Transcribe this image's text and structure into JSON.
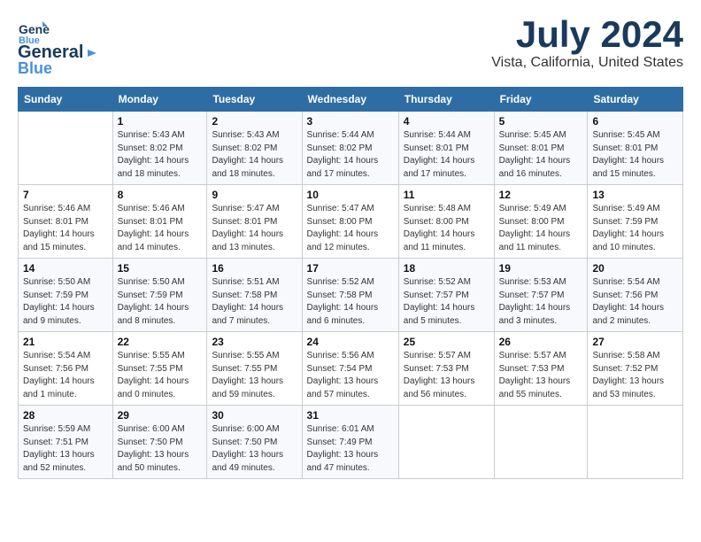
{
  "header": {
    "logo_general": "General",
    "logo_blue": "Blue",
    "month": "July 2024",
    "location": "Vista, California, United States"
  },
  "columns": [
    "Sunday",
    "Monday",
    "Tuesday",
    "Wednesday",
    "Thursday",
    "Friday",
    "Saturday"
  ],
  "weeks": [
    [
      {
        "num": "",
        "info": ""
      },
      {
        "num": "1",
        "info": "Sunrise: 5:43 AM\nSunset: 8:02 PM\nDaylight: 14 hours\nand 18 minutes."
      },
      {
        "num": "2",
        "info": "Sunrise: 5:43 AM\nSunset: 8:02 PM\nDaylight: 14 hours\nand 18 minutes."
      },
      {
        "num": "3",
        "info": "Sunrise: 5:44 AM\nSunset: 8:02 PM\nDaylight: 14 hours\nand 17 minutes."
      },
      {
        "num": "4",
        "info": "Sunrise: 5:44 AM\nSunset: 8:01 PM\nDaylight: 14 hours\nand 17 minutes."
      },
      {
        "num": "5",
        "info": "Sunrise: 5:45 AM\nSunset: 8:01 PM\nDaylight: 14 hours\nand 16 minutes."
      },
      {
        "num": "6",
        "info": "Sunrise: 5:45 AM\nSunset: 8:01 PM\nDaylight: 14 hours\nand 15 minutes."
      }
    ],
    [
      {
        "num": "7",
        "info": "Sunrise: 5:46 AM\nSunset: 8:01 PM\nDaylight: 14 hours\nand 15 minutes."
      },
      {
        "num": "8",
        "info": "Sunrise: 5:46 AM\nSunset: 8:01 PM\nDaylight: 14 hours\nand 14 minutes."
      },
      {
        "num": "9",
        "info": "Sunrise: 5:47 AM\nSunset: 8:01 PM\nDaylight: 14 hours\nand 13 minutes."
      },
      {
        "num": "10",
        "info": "Sunrise: 5:47 AM\nSunset: 8:00 PM\nDaylight: 14 hours\nand 12 minutes."
      },
      {
        "num": "11",
        "info": "Sunrise: 5:48 AM\nSunset: 8:00 PM\nDaylight: 14 hours\nand 11 minutes."
      },
      {
        "num": "12",
        "info": "Sunrise: 5:49 AM\nSunset: 8:00 PM\nDaylight: 14 hours\nand 11 minutes."
      },
      {
        "num": "13",
        "info": "Sunrise: 5:49 AM\nSunset: 7:59 PM\nDaylight: 14 hours\nand 10 minutes."
      }
    ],
    [
      {
        "num": "14",
        "info": "Sunrise: 5:50 AM\nSunset: 7:59 PM\nDaylight: 14 hours\nand 9 minutes."
      },
      {
        "num": "15",
        "info": "Sunrise: 5:50 AM\nSunset: 7:59 PM\nDaylight: 14 hours\nand 8 minutes."
      },
      {
        "num": "16",
        "info": "Sunrise: 5:51 AM\nSunset: 7:58 PM\nDaylight: 14 hours\nand 7 minutes."
      },
      {
        "num": "17",
        "info": "Sunrise: 5:52 AM\nSunset: 7:58 PM\nDaylight: 14 hours\nand 6 minutes."
      },
      {
        "num": "18",
        "info": "Sunrise: 5:52 AM\nSunset: 7:57 PM\nDaylight: 14 hours\nand 5 minutes."
      },
      {
        "num": "19",
        "info": "Sunrise: 5:53 AM\nSunset: 7:57 PM\nDaylight: 14 hours\nand 3 minutes."
      },
      {
        "num": "20",
        "info": "Sunrise: 5:54 AM\nSunset: 7:56 PM\nDaylight: 14 hours\nand 2 minutes."
      }
    ],
    [
      {
        "num": "21",
        "info": "Sunrise: 5:54 AM\nSunset: 7:56 PM\nDaylight: 14 hours\nand 1 minute."
      },
      {
        "num": "22",
        "info": "Sunrise: 5:55 AM\nSunset: 7:55 PM\nDaylight: 14 hours\nand 0 minutes."
      },
      {
        "num": "23",
        "info": "Sunrise: 5:55 AM\nSunset: 7:55 PM\nDaylight: 13 hours\nand 59 minutes."
      },
      {
        "num": "24",
        "info": "Sunrise: 5:56 AM\nSunset: 7:54 PM\nDaylight: 13 hours\nand 57 minutes."
      },
      {
        "num": "25",
        "info": "Sunrise: 5:57 AM\nSunset: 7:53 PM\nDaylight: 13 hours\nand 56 minutes."
      },
      {
        "num": "26",
        "info": "Sunrise: 5:57 AM\nSunset: 7:53 PM\nDaylight: 13 hours\nand 55 minutes."
      },
      {
        "num": "27",
        "info": "Sunrise: 5:58 AM\nSunset: 7:52 PM\nDaylight: 13 hours\nand 53 minutes."
      }
    ],
    [
      {
        "num": "28",
        "info": "Sunrise: 5:59 AM\nSunset: 7:51 PM\nDaylight: 13 hours\nand 52 minutes."
      },
      {
        "num": "29",
        "info": "Sunrise: 6:00 AM\nSunset: 7:50 PM\nDaylight: 13 hours\nand 50 minutes."
      },
      {
        "num": "30",
        "info": "Sunrise: 6:00 AM\nSunset: 7:50 PM\nDaylight: 13 hours\nand 49 minutes."
      },
      {
        "num": "31",
        "info": "Sunrise: 6:01 AM\nSunset: 7:49 PM\nDaylight: 13 hours\nand 47 minutes."
      },
      {
        "num": "",
        "info": ""
      },
      {
        "num": "",
        "info": ""
      },
      {
        "num": "",
        "info": ""
      }
    ]
  ]
}
